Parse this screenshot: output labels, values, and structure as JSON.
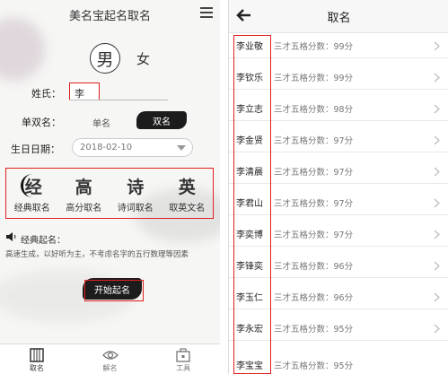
{
  "left": {
    "title": "美名宝起名取名",
    "gender": {
      "male": "男",
      "female": "女"
    },
    "surname": {
      "label": "姓氏：",
      "value": "李"
    },
    "name_type": {
      "label": "单双名：",
      "single": "单名",
      "double": "双名"
    },
    "birth": {
      "label": "生日日期：",
      "value": "2018-02-10"
    },
    "modes": [
      {
        "glyph": "经",
        "label": "经典取名"
      },
      {
        "glyph": "高",
        "label": "高分取名"
      },
      {
        "glyph": "诗",
        "label": "诗词取名"
      },
      {
        "glyph": "英",
        "label": "取英文名"
      }
    ],
    "description": {
      "title": "经典起名：",
      "text": "高速生成，以好听为主，不考虑名字的五行数理等因素"
    },
    "start_button": "开始起名",
    "tabs": [
      {
        "label": "取名",
        "icon": "book-icon"
      },
      {
        "label": "解名",
        "icon": "eye-icon"
      },
      {
        "label": "工具",
        "icon": "toolbox-icon"
      }
    ]
  },
  "right": {
    "title": "取名",
    "rows": [
      {
        "name": "李业敬",
        "score": "三才五格分数：99分"
      },
      {
        "name": "李钦乐",
        "score": "三才五格分数：99分"
      },
      {
        "name": "李立志",
        "score": "三才五格分数：98分"
      },
      {
        "name": "李金贤",
        "score": "三才五格分数：97分"
      },
      {
        "name": "李清晨",
        "score": "三才五格分数：97分"
      },
      {
        "name": "李君山",
        "score": "三才五格分数：97分"
      },
      {
        "name": "李奕博",
        "score": "三才五格分数：97分"
      },
      {
        "name": "李锋奕",
        "score": "三才五格分数：96分"
      },
      {
        "name": "李玉仁",
        "score": "三才五格分数：96分"
      },
      {
        "name": "李永宏",
        "score": "三才五格分数：95分"
      },
      {
        "name": "李宝宝",
        "score": "三才五格分数：95分"
      }
    ]
  }
}
